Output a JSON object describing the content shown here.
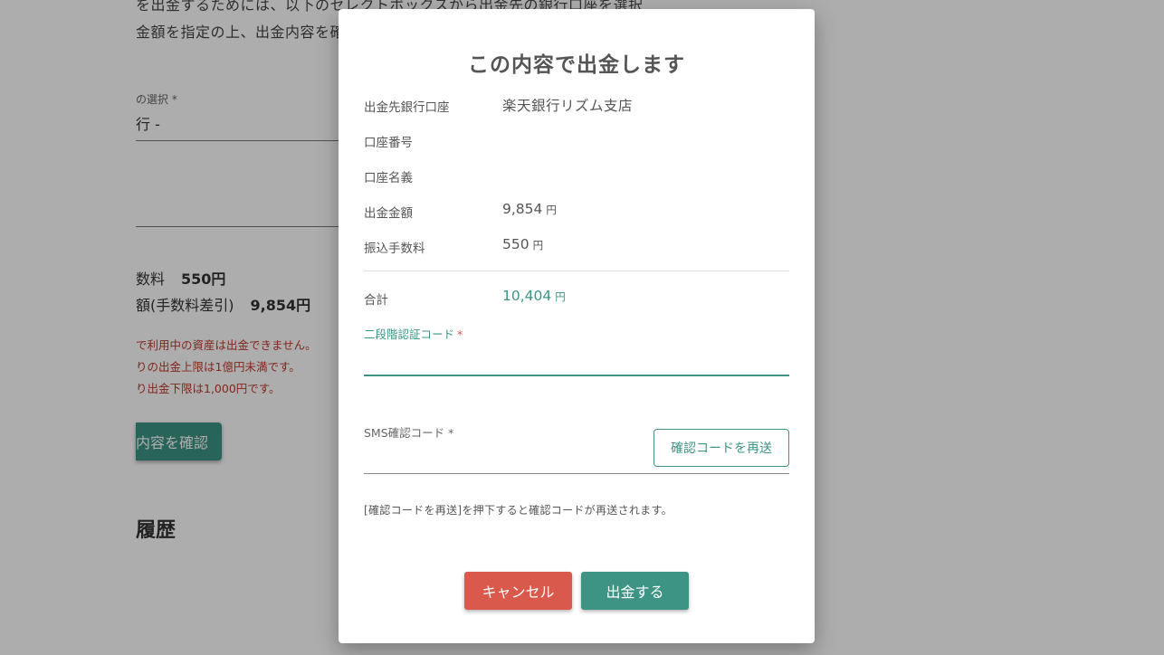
{
  "background": {
    "intro_line1": "を出金するためには、以下のセレクトボックスから出金先の銀行口座を選択",
    "intro_line2": "金額を指定の上、出金内容を確",
    "account_select_label": "の選択 *",
    "account_select_value": "行 -",
    "fee_label": "数料",
    "fee_value": "550円",
    "net_label": "額(手数料差引)",
    "net_value": "9,854円",
    "warning1": "で利用中の資産は出金できません。",
    "warning2": "りの出金上限は1億円未満です。",
    "warning3": "り出金下限は1,000円です。",
    "confirm_button": "内容を確認",
    "history_heading": "履歴"
  },
  "modal": {
    "title": "この内容で出金します",
    "rows": [
      {
        "label": "出金先銀行口座",
        "value": "楽天銀行リズム支店",
        "unit": ""
      },
      {
        "label": "口座番号",
        "value": "",
        "unit": ""
      },
      {
        "label": "口座名義",
        "value": "",
        "unit": ""
      },
      {
        "label": "出金金額",
        "value": "9,854",
        "unit": "円"
      },
      {
        "label": "振込手数料",
        "value": "550",
        "unit": "円"
      }
    ],
    "total": {
      "label": "合計",
      "value": "10,404",
      "unit": "円"
    },
    "two_factor": {
      "label": "二段階認証コード",
      "required_mark": "*",
      "value": ""
    },
    "sms": {
      "label": "SMS確認コード *",
      "value": ""
    },
    "resend_button": "確認コードを再送",
    "note": "[確認コードを再送]を押下すると確認コードが再送されます。",
    "cancel_button": "キャンセル",
    "submit_button": "出金する"
  },
  "colors": {
    "accent": "#3d9485",
    "danger": "#d9594c",
    "warning_text": "#c0392b"
  }
}
